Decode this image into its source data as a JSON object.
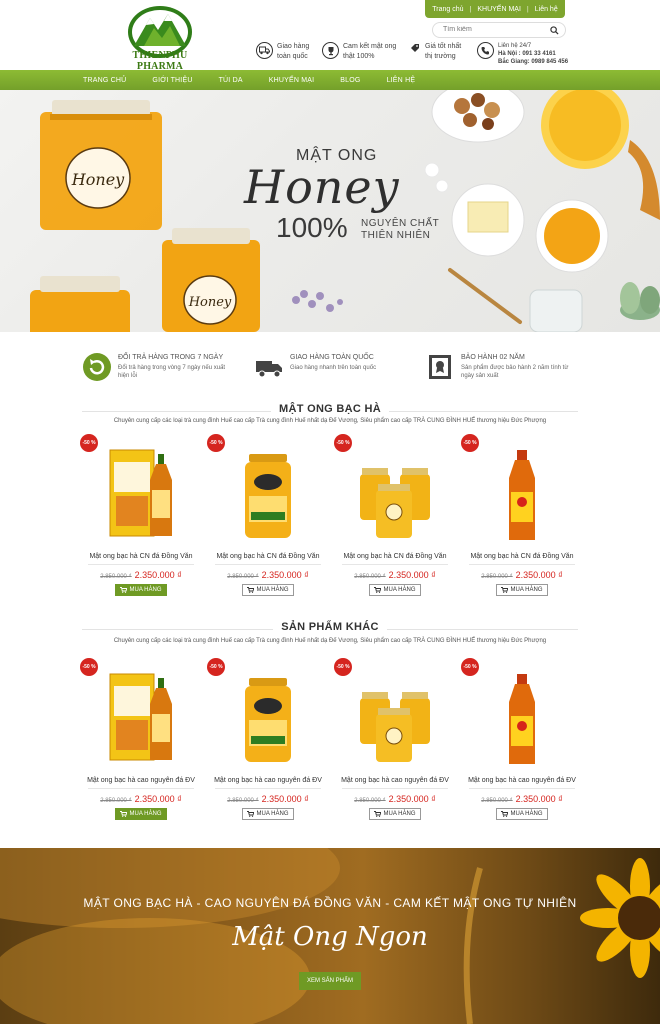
{
  "header": {
    "logo_text": "THIENPHU PHARMA",
    "top_links": [
      "Trang chủ",
      "KHUYẾN MẠI",
      "Liên hệ"
    ],
    "search_placeholder": "Tìm kiếm",
    "features": [
      {
        "icon": "truck-icon",
        "lines": [
          "Giao hàng",
          "toàn quốc"
        ]
      },
      {
        "icon": "trophy-icon",
        "lines": [
          "Cam kết mật ong",
          "thật 100%"
        ]
      },
      {
        "icon": "tag-icon",
        "lines": [
          "Giá tốt nhất",
          "thị trường"
        ]
      }
    ],
    "contact": {
      "title": "Liên hệ 24/7",
      "line1": "Hà Nội : 091 33 4161",
      "line2": "Bắc Giang: 0989 845 456"
    }
  },
  "nav": [
    "TRANG CHỦ",
    "GIỚI THIỆU",
    "TÚI DA",
    "KHUYẾN MẠI",
    "BLOG",
    "LIÊN HỆ"
  ],
  "banner": {
    "subtitle": "MẬT ONG",
    "headline": "Honey",
    "percent": "100%",
    "tag1": "NGUYÊN CHẤT",
    "tag2": "THIÊN NHIÊN"
  },
  "services": [
    {
      "icon": "return-icon",
      "title": "ĐỔI TRẢ HÀNG TRONG 7 NGÀY",
      "desc": "Đổi trả hàng trong vòng 7 ngày nếu xuất hiện lỗi"
    },
    {
      "icon": "delivery-truck-icon",
      "title": "GIAO HÀNG TOÀN QUỐC",
      "desc": "Giao hàng nhanh trên toàn quốc"
    },
    {
      "icon": "certificate-icon",
      "title": "BẢO HÀNH 02 NĂM",
      "desc": "Sản phẩm được bảo hành 2 năm tính từ ngày sản xuất"
    }
  ],
  "sections": [
    {
      "title": "MẬT ONG BẠC HÀ",
      "desc": "Chuyên cung cấp các loại trà cung đình Huế cao cấp Trà cung đình Huế nhất dạ Đế Vương, Siêu phẩm cao cấp TRÀ CUNG ĐÌNH HUẾ thương hiệu Đức Phượng",
      "products": [
        {
          "name": "Mật ong bạc hà CN  đá Đồng Văn",
          "badge": "-50 %",
          "old": "2.850.000 ₫",
          "price": "2.350.000 ₫",
          "button": "MUA HÀNG",
          "image": "box-bottle"
        },
        {
          "name": "Mật ong bạc hà CN  đá Đồng Văn",
          "badge": "-50 %",
          "old": "2.850.000 ₫",
          "price": "2.350.000 ₫",
          "button": "MUA HÀNG",
          "image": "jar"
        },
        {
          "name": "Mật ong bạc hà CN  đá Đồng Văn",
          "badge": "-50 %",
          "old": "2.850.000 ₫",
          "price": "2.350.000 ₫",
          "button": "MUA HÀNG",
          "image": "jars-set"
        },
        {
          "name": "Mật ong bạc hà CN  đá Đồng Văn",
          "badge": "-50 %",
          "old": "2.850.000 ₫",
          "price": "2.350.000 ₫",
          "button": "MUA HÀNG",
          "image": "bottle"
        }
      ]
    },
    {
      "title": "SẢN PHẨM KHÁC",
      "desc": "Chuyên cung cấp các loại trà cung đình Huế cao cấp Trà cung đình Huế nhất dạ Đế Vương, Siêu phẩm cao cấp TRÀ CUNG ĐÌNH HUẾ thương hiệu Đức Phượng",
      "products": [
        {
          "name": "Mật ong bạc hà cao nguyên đá ĐV",
          "badge": "-50 %",
          "old": "2.850.000 ₫",
          "price": "2.350.000 ₫",
          "button": "MUA HÀNG",
          "image": "box-bottle"
        },
        {
          "name": "Mật ong bạc hà cao nguyên đá ĐV",
          "badge": "-50 %",
          "old": "2.850.000 ₫",
          "price": "2.350.000 ₫",
          "button": "MUA HÀNG",
          "image": "jar"
        },
        {
          "name": "Mật ong bạc hà cao nguyên đá ĐV",
          "badge": "-50 %",
          "old": "2.850.000 ₫",
          "price": "2.350.000 ₫",
          "button": "MUA HÀNG",
          "image": "jars-set"
        },
        {
          "name": "Mật ong bạc hà cao nguyên đá ĐV",
          "badge": "-50 %",
          "old": "2.850.000 ₫",
          "price": "2.350.000 ₫",
          "button": "MUA HÀNG",
          "image": "bottle"
        }
      ]
    }
  ],
  "footer_banner": {
    "line1": "MẬT ONG BẠC HÀ - CAO NGUYÊN ĐÁ ĐỒNG VĂN - CAM KẾT MẬT ONG TỰ NHIÊN",
    "script": "Mật Ong Ngon",
    "button": "XEM SẢN PHẨM"
  },
  "colors": {
    "brand_green": "#7ea52e",
    "sale_red": "#d5251f",
    "honey": "#f2a413"
  }
}
